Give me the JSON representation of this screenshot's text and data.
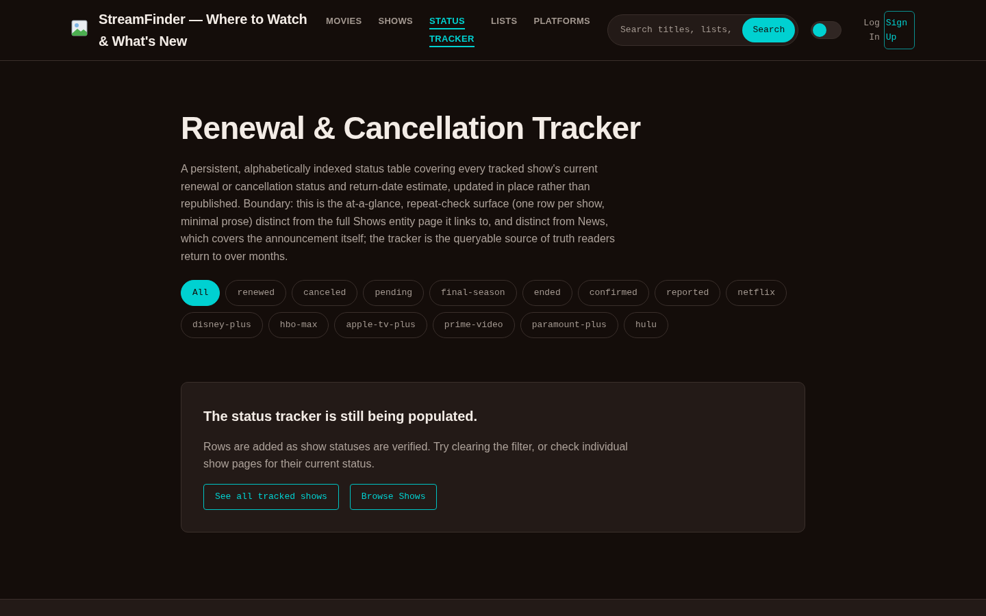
{
  "header": {
    "brand": "StreamFinder — Where to Watch & What's New",
    "nav": [
      {
        "label": "MOVIES",
        "selected": false
      },
      {
        "label": "SHOWS",
        "selected": false
      },
      {
        "label": "STATUS TRACKER",
        "selected": true
      },
      {
        "label": "LISTS",
        "selected": false
      },
      {
        "label": "PLATFORMS",
        "selected": false
      }
    ],
    "search": {
      "placeholder": "Search titles, lists,",
      "button": "Search"
    },
    "theme_toggle": {
      "on": false
    },
    "log_in": "Log In",
    "sign_up": "Sign Up"
  },
  "page": {
    "title": "Renewal & Cancellation Tracker",
    "description": "A persistent, alphabetically indexed status table covering every tracked show's current renewal or cancellation status and return-date estimate, updated in place rather than republished. Boundary: this is the at-a-glance, repeat-check surface (one row per show, minimal prose) distinct from the full Shows entity page it links to, and distinct from News, which covers the announcement itself; the tracker is the queryable source of truth readers return to over months.",
    "filters": [
      {
        "label": "All",
        "selected": true
      },
      {
        "label": "renewed",
        "selected": false
      },
      {
        "label": "canceled",
        "selected": false
      },
      {
        "label": "pending",
        "selected": false
      },
      {
        "label": "final-season",
        "selected": false
      },
      {
        "label": "ended",
        "selected": false
      },
      {
        "label": "confirmed",
        "selected": false
      },
      {
        "label": "reported",
        "selected": false
      },
      {
        "label": "netflix",
        "selected": false
      },
      {
        "label": "disney-plus",
        "selected": false
      },
      {
        "label": "hbo-max",
        "selected": false
      },
      {
        "label": "apple-tv-plus",
        "selected": false
      },
      {
        "label": "prime-video",
        "selected": false
      },
      {
        "label": "paramount-plus",
        "selected": false
      },
      {
        "label": "hulu",
        "selected": false
      }
    ]
  },
  "empty_state": {
    "title": "The status tracker is still being populated.",
    "text": "Rows are added as show statuses are verified. Try clearing the filter, or check individual show pages for their current status.",
    "actions": [
      "See all tracked shows",
      "Browse Shows"
    ]
  }
}
